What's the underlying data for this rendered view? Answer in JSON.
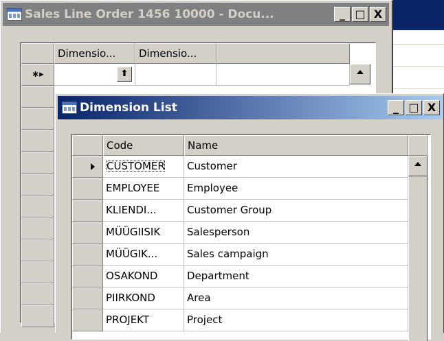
{
  "background_window": {
    "accent_color": "#0a246a"
  },
  "sales_window": {
    "title": "Sales Line Order 1456 10000 - Docu...",
    "controls": {
      "minimize": "_",
      "maximize": "□",
      "close": "X"
    },
    "columns": [
      "Dimensio...",
      "Dimensio..."
    ],
    "new_row_marker": "∗▸",
    "lookup_icon": "up-arrow-icon"
  },
  "dimension_list": {
    "title": "Dimension List",
    "controls": {
      "minimize": "_",
      "maximize": "□",
      "close": "X"
    },
    "columns": {
      "code": "Code",
      "name": "Name"
    },
    "rows": [
      {
        "code": "CUSTOMER",
        "name": "Customer"
      },
      {
        "code": "EMPLOYEE",
        "name": "Employee"
      },
      {
        "code": "KLIENDI...",
        "name": "Customer Group"
      },
      {
        "code": "MÜÜGIISIK",
        "name": "Salesperson"
      },
      {
        "code": "MÜÜGIK...",
        "name": "Sales campaign"
      },
      {
        "code": "OSAKOND",
        "name": "Department"
      },
      {
        "code": "PIIRKOND",
        "name": "Area"
      },
      {
        "code": "PROJEKT",
        "name": "Project"
      }
    ],
    "selected_row": 0
  }
}
